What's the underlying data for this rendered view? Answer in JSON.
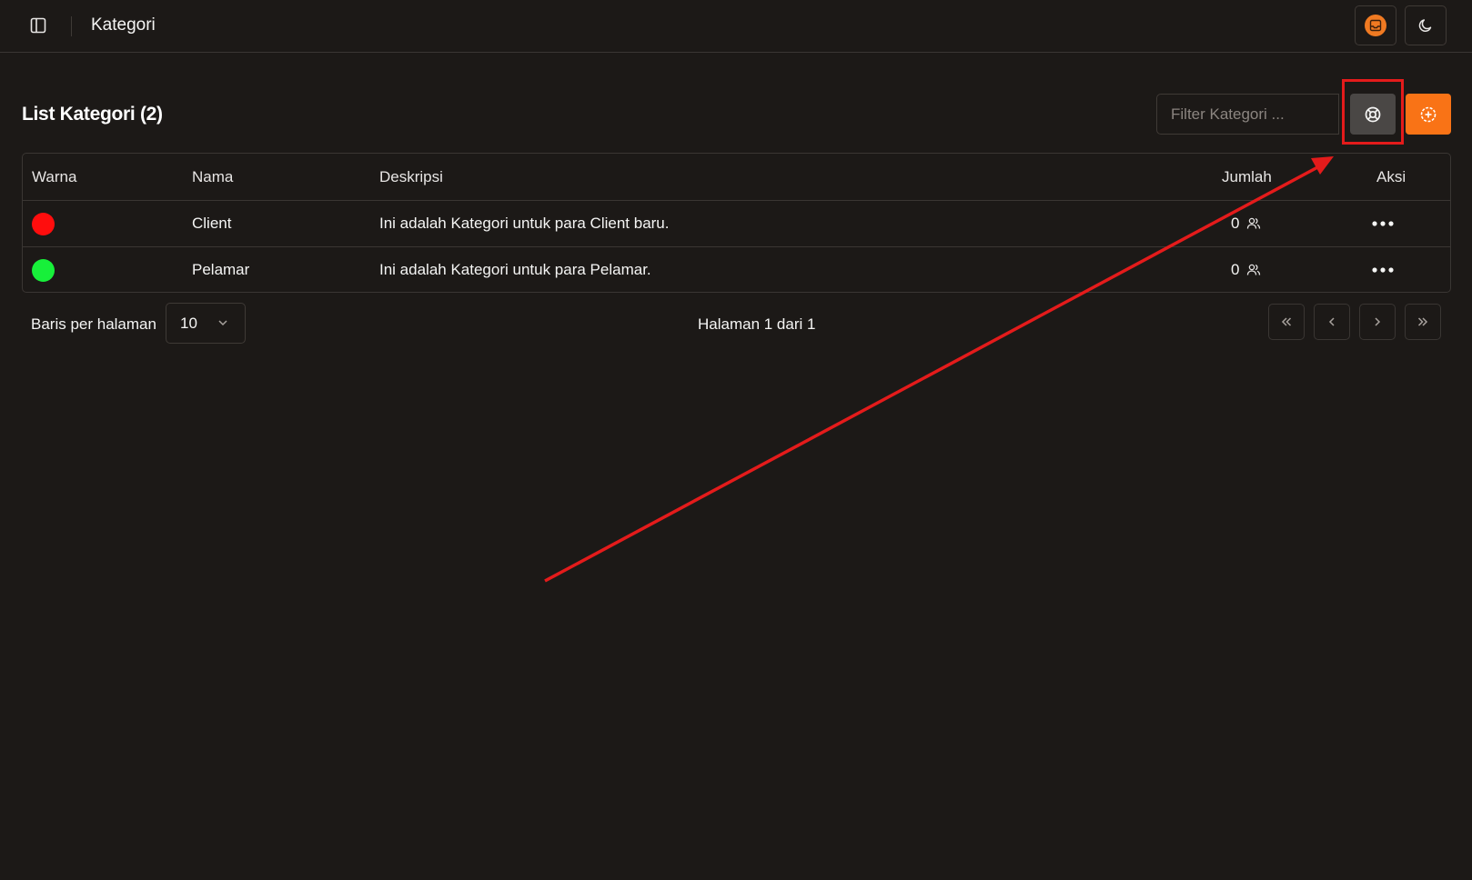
{
  "header": {
    "title": "Kategori",
    "icons": {
      "sidebar_toggle": "sidebar-icon",
      "avatar": "inbox-avatar-icon",
      "theme": "moon-icon"
    }
  },
  "list": {
    "title": "List Kategori (2)",
    "filter_placeholder": "Filter Kategori ...",
    "reset_icon": "lifebuoy-icon",
    "add_icon": "plus-circle-icon"
  },
  "table": {
    "headers": {
      "warna": "Warna",
      "nama": "Nama",
      "deskripsi": "Deskripsi",
      "jumlah": "Jumlah",
      "aksi": "Aksi"
    },
    "rows": [
      {
        "color": "#ff0d0d",
        "nama": "Client",
        "deskripsi": "Ini adalah Kategori untuk para Client baru.",
        "jumlah": "0"
      },
      {
        "color": "#17f03a",
        "nama": "Pelamar",
        "deskripsi": "Ini adalah Kategori untuk para Pelamar.",
        "jumlah": "0"
      }
    ]
  },
  "pagination": {
    "rows_label": "Baris per halaman",
    "page_size": "10",
    "page_info": "Halaman 1 dari 1"
  },
  "colors": {
    "accent": "#f97316",
    "annotation": "#e41b1b",
    "background": "#1c1917"
  }
}
